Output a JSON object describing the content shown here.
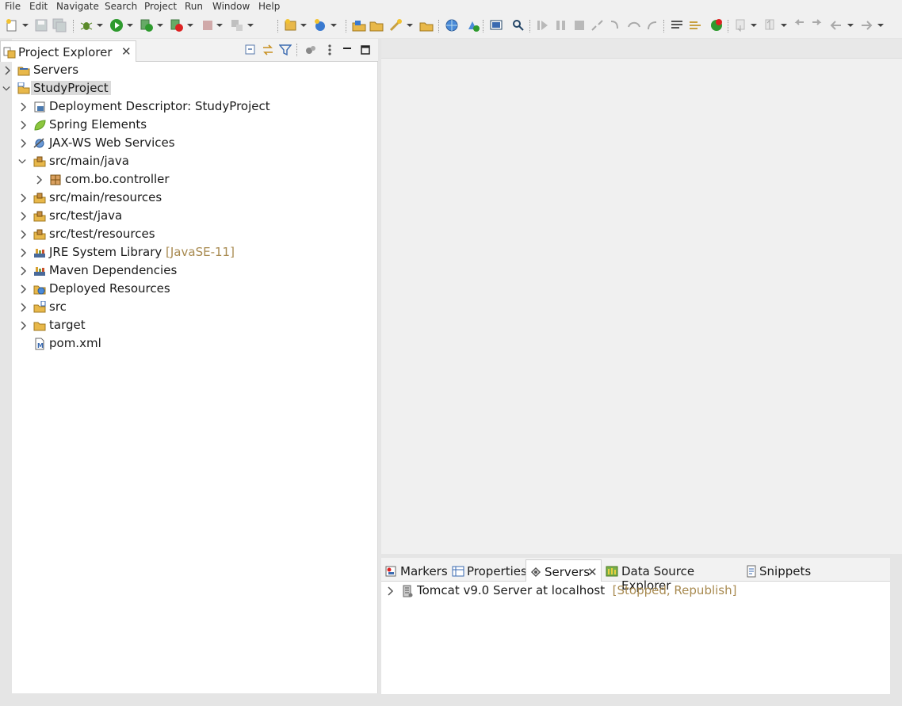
{
  "menu": [
    "File",
    "Edit",
    "Navigate",
    "Search",
    "Project",
    "Run",
    "Window",
    "Help"
  ],
  "project_explorer": {
    "tab_label": "Project Explorer",
    "tree": [
      {
        "label": "Servers",
        "icon": "folder-icon",
        "expanded": false
      },
      {
        "label": "StudyProject",
        "icon": "project-icon",
        "expanded": true,
        "selected": true
      },
      {
        "label": "Deployment Descriptor: StudyProject",
        "icon": "deployment-descriptor-icon"
      },
      {
        "label": "Spring Elements",
        "icon": "spring-leaf-icon"
      },
      {
        "label": "JAX-WS Web Services",
        "icon": "web-services-icon"
      },
      {
        "label": "src/main/java",
        "icon": "source-folder-icon",
        "expanded": true
      },
      {
        "label": "com.bo.controller",
        "icon": "package-icon"
      },
      {
        "label": "src/main/resources",
        "icon": "source-folder-icon"
      },
      {
        "label": "src/test/java",
        "icon": "source-folder-icon"
      },
      {
        "label": "src/test/resources",
        "icon": "source-folder-icon"
      },
      {
        "label": "JRE System Library",
        "decoration": "[JavaSE-11]",
        "icon": "library-icon"
      },
      {
        "label": "Maven Dependencies",
        "icon": "library-icon"
      },
      {
        "label": "Deployed Resources",
        "icon": "deployed-resources-icon"
      },
      {
        "label": "src",
        "icon": "folder-icon"
      },
      {
        "label": "target",
        "icon": "folder-icon"
      },
      {
        "label": "pom.xml",
        "icon": "maven-file-icon"
      }
    ]
  },
  "bottom_panel": {
    "tabs": [
      "Markers",
      "Properties",
      "Servers",
      "Data Source Explorer",
      "Snippets"
    ],
    "active_tab": "Servers",
    "servers": [
      {
        "name": "Tomcat v9.0 Server at localhost",
        "status": "[Stopped, Republish]"
      }
    ]
  },
  "colors": {
    "decoration": "#a88a50",
    "selection": "#dadada",
    "folder": "#e8b84a"
  }
}
